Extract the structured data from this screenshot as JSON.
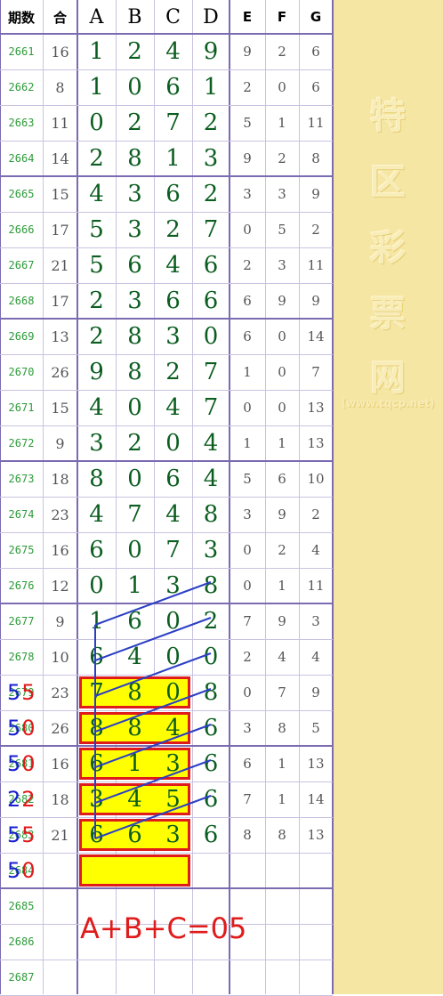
{
  "chart_data": {
    "type": "table",
    "headers": [
      "期数",
      "合",
      "A",
      "B",
      "C",
      "D",
      "E",
      "F",
      "G"
    ],
    "rows": [
      [
        "2661",
        "16",
        "1",
        "2",
        "4",
        "9",
        "9",
        "2",
        "6"
      ],
      [
        "2662",
        "8",
        "1",
        "0",
        "6",
        "1",
        "2",
        "0",
        "6"
      ],
      [
        "2663",
        "11",
        "0",
        "2",
        "7",
        "2",
        "5",
        "1",
        "11"
      ],
      [
        "2664",
        "14",
        "2",
        "8",
        "1",
        "3",
        "9",
        "2",
        "8"
      ],
      [
        "2665",
        "15",
        "4",
        "3",
        "6",
        "2",
        "3",
        "3",
        "9"
      ],
      [
        "2666",
        "17",
        "5",
        "3",
        "2",
        "7",
        "0",
        "5",
        "2"
      ],
      [
        "2667",
        "21",
        "5",
        "6",
        "4",
        "6",
        "2",
        "3",
        "11"
      ],
      [
        "2668",
        "17",
        "2",
        "3",
        "6",
        "6",
        "6",
        "9",
        "9"
      ],
      [
        "2669",
        "13",
        "2",
        "8",
        "3",
        "0",
        "6",
        "0",
        "14"
      ],
      [
        "2670",
        "26",
        "9",
        "8",
        "2",
        "7",
        "1",
        "0",
        "7"
      ],
      [
        "2671",
        "15",
        "4",
        "0",
        "4",
        "7",
        "0",
        "0",
        "13"
      ],
      [
        "2672",
        "9",
        "3",
        "2",
        "0",
        "4",
        "1",
        "1",
        "13"
      ],
      [
        "2673",
        "18",
        "8",
        "0",
        "6",
        "4",
        "5",
        "6",
        "10"
      ],
      [
        "2674",
        "23",
        "4",
        "7",
        "4",
        "8",
        "3",
        "9",
        "2"
      ],
      [
        "2675",
        "16",
        "6",
        "0",
        "7",
        "3",
        "0",
        "2",
        "4"
      ],
      [
        "2676",
        "12",
        "0",
        "1",
        "3",
        "8",
        "0",
        "1",
        "11"
      ],
      [
        "2677",
        "9",
        "1",
        "6",
        "0",
        "2",
        "7",
        "9",
        "3"
      ],
      [
        "2678",
        "10",
        "6",
        "4",
        "0",
        "0",
        "2",
        "4",
        "4"
      ],
      [
        "2679",
        "23",
        "7",
        "8",
        "0",
        "8",
        "0",
        "7",
        "9"
      ],
      [
        "2680",
        "26",
        "8",
        "8",
        "4",
        "6",
        "3",
        "8",
        "5"
      ],
      [
        "2681",
        "16",
        "6",
        "1",
        "3",
        "6",
        "6",
        "1",
        "13"
      ],
      [
        "2682",
        "18",
        "3",
        "4",
        "5",
        "6",
        "7",
        "1",
        "14"
      ],
      [
        "2683",
        "21",
        "6",
        "6",
        "3",
        "6",
        "8",
        "8",
        "13"
      ],
      [
        "2684",
        "",
        "",
        "",
        "",
        "",
        "",
        "",
        ""
      ],
      [
        "2685",
        "",
        "",
        "",
        "",
        "",
        "",
        "",
        ""
      ],
      [
        "2686",
        "",
        "",
        "",
        "",
        "",
        "",
        "",
        ""
      ],
      [
        "2687",
        "",
        "",
        "",
        "",
        "",
        "",
        "",
        ""
      ]
    ],
    "highlighted_rows": [
      18,
      19,
      20,
      21,
      22,
      23
    ],
    "annotations": [
      {
        "row": 18,
        "text": "55"
      },
      {
        "row": 19,
        "text": "50"
      },
      {
        "row": 20,
        "text": "50"
      },
      {
        "row": 21,
        "text": "22"
      },
      {
        "row": 22,
        "text": "55"
      },
      {
        "row": 23,
        "text": "50"
      }
    ],
    "formula": "A+B+C=05",
    "colors": {
      "digit": "#0b5e1f",
      "period": "#2e9a3a",
      "grid": "#7b6bb0",
      "highlight_fill": "#ffff00",
      "highlight_border": "#e01b1b",
      "trend_line": "#2b3fc4",
      "annotation_blue": "#1a1fd0",
      "annotation_red": "#e01b1b",
      "side_panel": "#f5e6a3"
    }
  },
  "watermark": {
    "chars": [
      "特",
      "区",
      "彩",
      "票",
      "网"
    ],
    "url": "(www.tqcp.net)"
  }
}
